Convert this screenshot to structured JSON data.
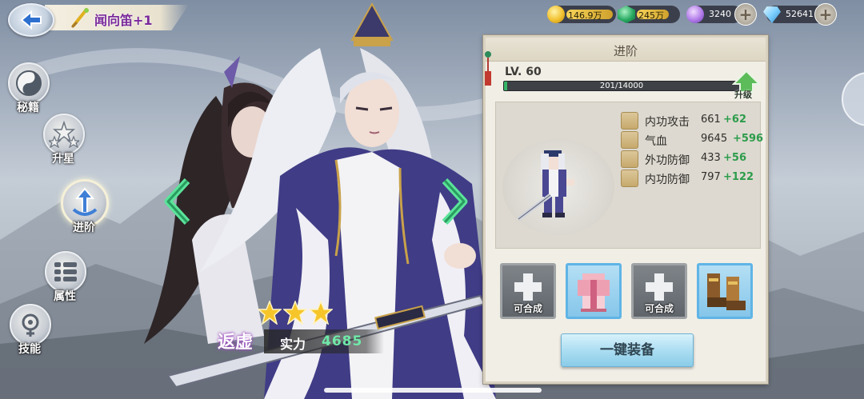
{
  "title_banner": {
    "text": "闻向笛+1"
  },
  "currencies": [
    {
      "icon": "gold-coin-icon",
      "value": "146.9万",
      "color": "#f2c12e"
    },
    {
      "icon": "green-gem-icon",
      "value": "245万",
      "color": "#27a860"
    },
    {
      "icon": "purple-crystal-icon",
      "value": "3240",
      "color": "#b07ae8"
    },
    {
      "icon": "diamond-icon",
      "value": "52641",
      "color": "#7fd0ff"
    }
  ],
  "menu": [
    {
      "icon": "yin-yang-icon",
      "label": "秘籍"
    },
    {
      "icon": "stars-icon",
      "label": "升星"
    },
    {
      "icon": "advance-arrow-icon",
      "label": "进阶",
      "active": true
    },
    {
      "icon": "attributes-icon",
      "label": "属性"
    },
    {
      "icon": "skill-icon",
      "label": "技能"
    }
  ],
  "hero": {
    "star_count": 3,
    "rank": "返虚",
    "power_label": "实力",
    "power_value": "4685"
  },
  "panel": {
    "title": "进阶",
    "level": "LV. 60",
    "exp_text": "201/14000",
    "exp_fraction": 0.0144,
    "upgrade_label": "升级",
    "stats": [
      {
        "icon": "sword-icon",
        "name": "内功攻击",
        "value": "661",
        "bonus": "+62"
      },
      {
        "icon": "heart-icon",
        "name": "气血",
        "value": "9645",
        "bonus": "+596"
      },
      {
        "icon": "armor-icon",
        "name": "外功防御",
        "value": "433",
        "bonus": "+56"
      },
      {
        "icon": "shield-icon",
        "name": "内功防御",
        "value": "797",
        "bonus": "+122"
      }
    ],
    "equipment": [
      {
        "state": "empty",
        "label": "可合成"
      },
      {
        "state": "filled",
        "item": "pink-robe-icon",
        "label": ""
      },
      {
        "state": "empty",
        "label": "可合成"
      },
      {
        "state": "filled",
        "item": "boots-icon",
        "label": ""
      }
    ],
    "equip_all_label": "一键装备"
  }
}
